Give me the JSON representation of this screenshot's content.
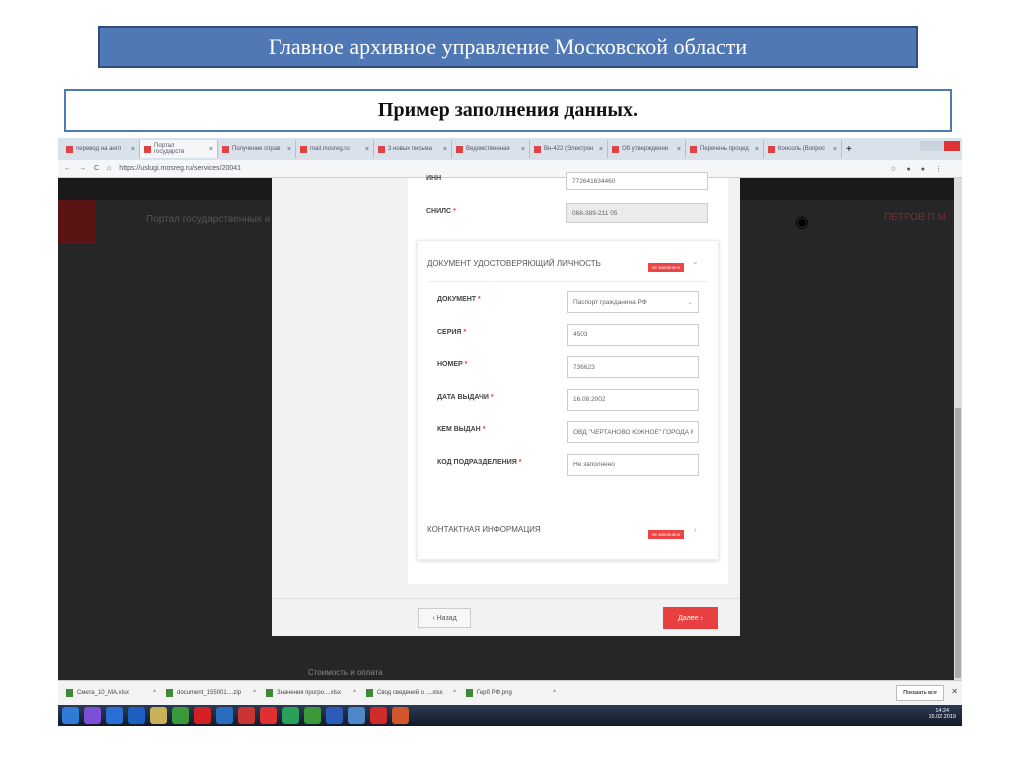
{
  "slide": {
    "title": "Главное архивное управление Московской области",
    "subtitle": "Пример заполнения данных."
  },
  "browser": {
    "tabs": [
      "перевод на англ",
      "Портал государств",
      "Получение справ",
      "mail.mosreg.ru",
      "3 новых письма",
      "Ведомственная",
      "Вн-422 (Электрон",
      "Об утверждении",
      "Перечень процед",
      "Консоль (Вопрос"
    ],
    "active_tab": 1,
    "url": "https://uslugi.mosreg.ru/services/20041"
  },
  "portal": {
    "name": "Портал государственных и му",
    "user": "ПЕТРОВ П.М."
  },
  "form": {
    "inn": {
      "label": "ИНН",
      "value": "772641634460"
    },
    "snils": {
      "label": "СНИЛС",
      "value": "068-389-211 05"
    },
    "doc_section": {
      "title": "ДОКУМЕНТ УДОСТОВЕРЯЮЩИЙ ЛИЧНОСТЬ",
      "badge": "не заполнено"
    },
    "fields": [
      {
        "label": "ДОКУМЕНТ",
        "value": "Паспорт гражданина РФ",
        "type": "select"
      },
      {
        "label": "СЕРИЯ",
        "value": "4503"
      },
      {
        "label": "НОМЕР",
        "value": "736623"
      },
      {
        "label": "ДАТА ВЫДАЧИ",
        "value": "16.08.2002"
      },
      {
        "label": "КЕМ ВЫДАН",
        "value": "ОВД \"ЧЕРТАНОВО ЮЖНОЕ\" ГОРОДА М"
      },
      {
        "label": "КОД ПОДРАЗДЕЛЕНИЯ",
        "value": "Не заполнено"
      }
    ],
    "contact_section": {
      "title": "КОНТАКТНАЯ ИНФОРМАЦИЯ",
      "badge": "не заполнено"
    },
    "back": "‹ Назад",
    "next": "Далее ›",
    "behind": "Стоимость и оплата"
  },
  "downloads": {
    "items": [
      "Смета_10_МА.xlsx",
      "document_155001....zip",
      "Значения прогро....xlsx",
      "Свод сведений о ....xlsx",
      "Герб РФ.png"
    ],
    "show_all": "Показать все"
  },
  "taskbar": {
    "time": "14:24",
    "date": "15.02.2019",
    "icon_colors": [
      "#2f7bd6",
      "#7b4fd6",
      "#2a6fd6",
      "#1e5fc2",
      "#c9b15a",
      "#3a9a3a",
      "#d42020",
      "#2b6dbf",
      "#c33",
      "#e03030",
      "#2aa05a",
      "#3a9a3a",
      "#2b5db8",
      "#4d88c8",
      "#d02b2b",
      "#d2552b"
    ]
  },
  "colors": {
    "accent": "#e44444",
    "title_bg": "#4f78b4"
  }
}
